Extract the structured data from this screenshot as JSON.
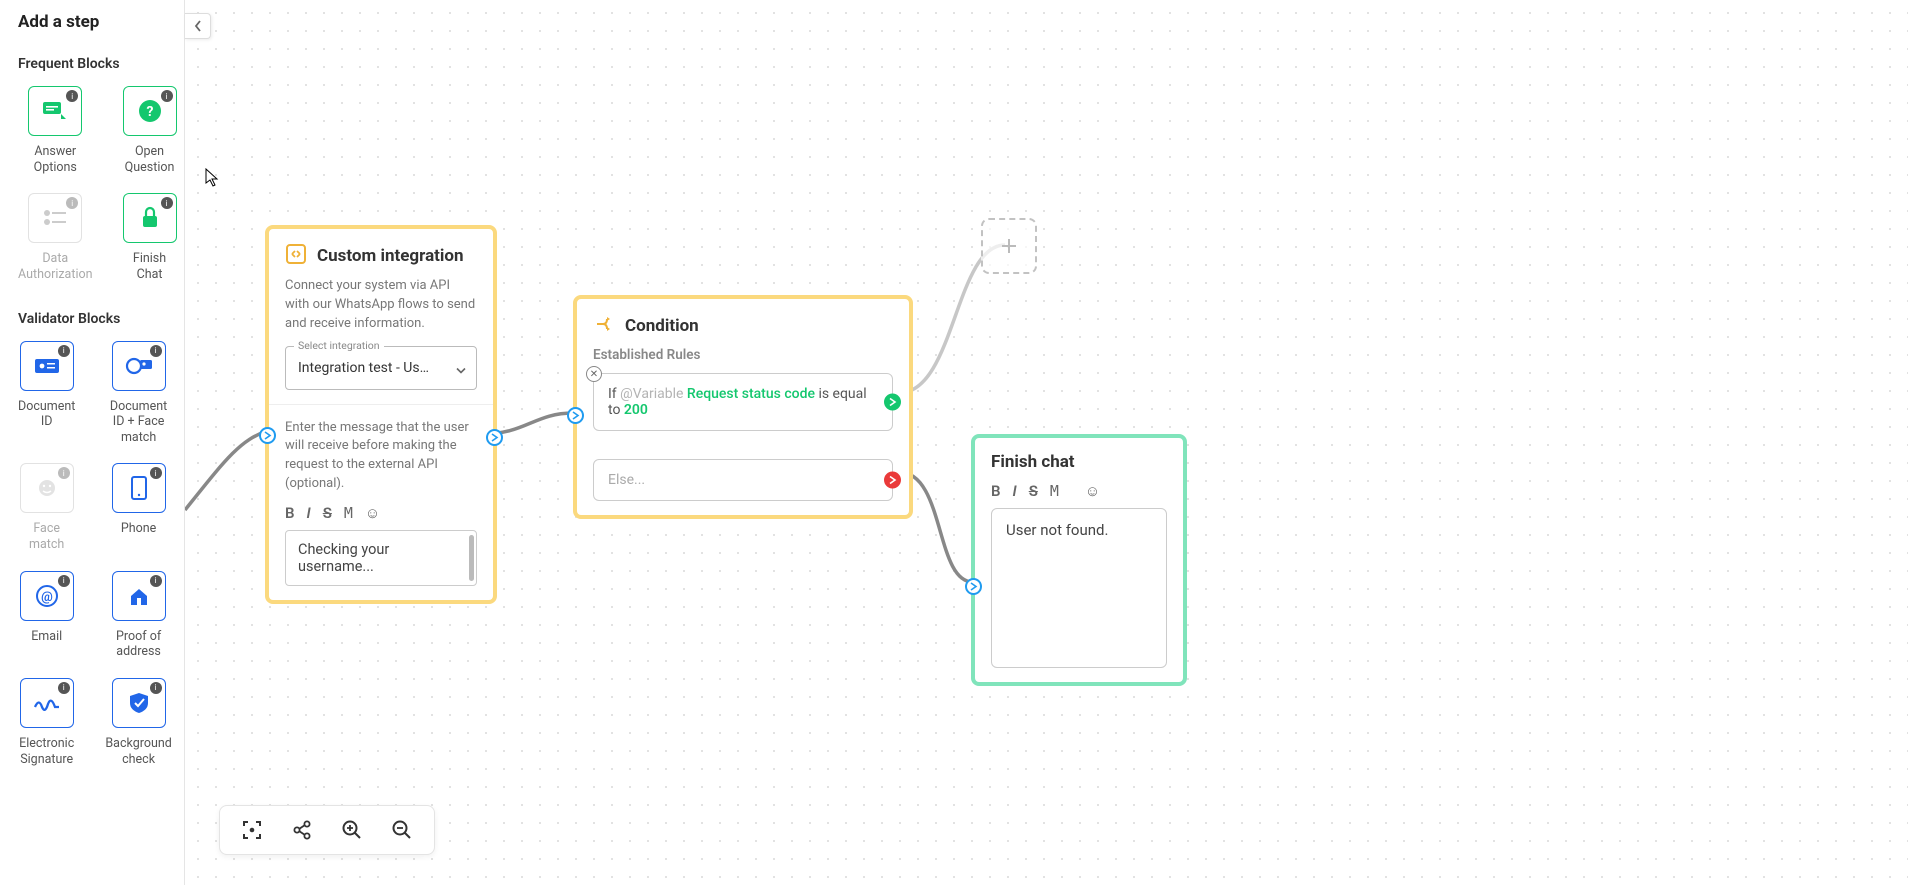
{
  "sidebar": {
    "title": "Add a step",
    "sections": {
      "frequent": {
        "title": "Frequent Blocks",
        "items": [
          {
            "label": "Answer\nOptions",
            "icon": "answer-options-icon",
            "variant": "green"
          },
          {
            "label": "Open\nQuestion",
            "icon": "open-question-icon",
            "variant": "green"
          },
          {
            "label": "Data\nAuthorization",
            "icon": "data-auth-icon",
            "variant": "gray",
            "disabled": true
          },
          {
            "label": "Finish\nChat",
            "icon": "finish-chat-icon",
            "variant": "green"
          }
        ]
      },
      "validator": {
        "title": "Validator Blocks",
        "items": [
          {
            "label": "Document\nID",
            "icon": "document-id-icon",
            "variant": "blue"
          },
          {
            "label": "Document\nID + Face\nmatch",
            "icon": "doc-face-icon",
            "variant": "blue"
          },
          {
            "label": "Face\nmatch",
            "icon": "face-match-icon",
            "variant": "gray",
            "disabled": true
          },
          {
            "label": "Phone",
            "icon": "phone-icon",
            "variant": "blue"
          },
          {
            "label": "Email",
            "icon": "email-icon",
            "variant": "blue"
          },
          {
            "label": "Proof of\naddress",
            "icon": "proof-address-icon",
            "variant": "blue"
          },
          {
            "label": "Electronic\nSignature",
            "icon": "signature-icon",
            "variant": "blue"
          },
          {
            "label": "Background\ncheck",
            "icon": "bg-check-icon",
            "variant": "blue"
          }
        ]
      }
    }
  },
  "canvas": {
    "toolbar": {
      "fit": "fit-screen-icon",
      "share": "share-icon",
      "zoom_in": "zoom-in-icon",
      "zoom_out": "zoom-out-icon"
    }
  },
  "nodes": {
    "custom_integration": {
      "title": "Custom integration",
      "description": "Connect your system via API with our WhatsApp flows to send and receive information.",
      "select_label": "Select integration",
      "select_value": "Integration test - Us…",
      "message_hint": "Enter the message that the user will receive before making the request to the external API (optional).",
      "format_toolbar": [
        "B",
        "I",
        "S",
        "M",
        "☺"
      ],
      "message_value": "Checking your username..."
    },
    "condition": {
      "title": "Condition",
      "rules_title": "Established Rules",
      "rule": {
        "if": "If",
        "variable_prefix": "@Variable",
        "variable_name": "Request status code",
        "operator": "is equal to",
        "value": "200"
      },
      "else_label": "Else..."
    },
    "finish_chat": {
      "title": "Finish chat",
      "format_toolbar": [
        "B",
        "I",
        "S",
        "M",
        "☺"
      ],
      "message_value": "User not found."
    }
  }
}
